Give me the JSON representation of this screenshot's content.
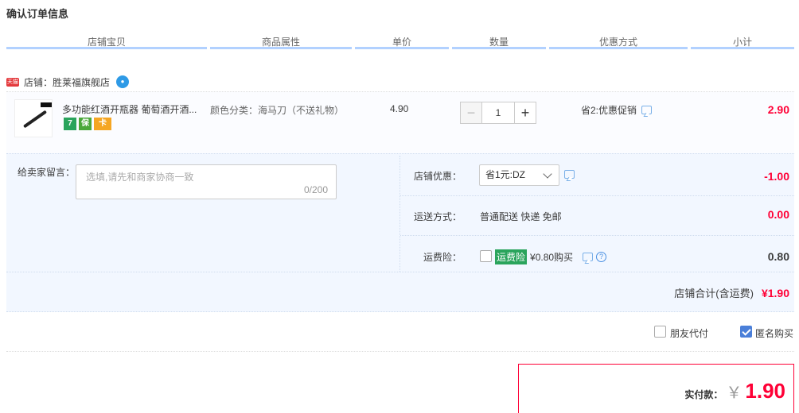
{
  "page": {
    "title": "确认订单信息"
  },
  "columns": [
    "店铺宝贝",
    "商品属性",
    "单价",
    "数量",
    "优惠方式",
    "小计"
  ],
  "shop": {
    "badge": "天猫",
    "label": "店铺：胜莱福旗舰店"
  },
  "item": {
    "title": "多功能红酒开瓶器 葡萄酒开酒...",
    "badges": [
      "7",
      "保",
      "卡"
    ],
    "attr": "颜色分类：海马刀（不送礼物）",
    "price": "4.90",
    "qty": "1",
    "minus": "−",
    "plus": "+",
    "promo": "省2:优惠促销",
    "subtotal": "2.90"
  },
  "message": {
    "label": "给卖家留言：",
    "placeholder": "选填,请先和商家协商一致",
    "counter": "0/200"
  },
  "store_discount": {
    "label": "店铺优惠：",
    "selected": "省1元:DZ",
    "amount": "-1.00"
  },
  "shipping": {
    "label": "运送方式：",
    "value": "普通配送 快递 免邮",
    "amount": "0.00"
  },
  "insurance": {
    "label": "运费险：",
    "tag": "运费险",
    "text": "¥0.80购买",
    "help": "?",
    "amount": "0.80"
  },
  "store_total": {
    "label": "店铺合计(含运费)",
    "value": "¥1.90"
  },
  "options": {
    "friend_pay": "朋友代付",
    "anonymous": "匿名购买"
  },
  "payment": {
    "label": "实付款：",
    "currency": "￥",
    "amount": "1.90"
  },
  "colors": {
    "accent_red": "#ff0036",
    "header_line": "#b2d1ff",
    "panel_bg": "#f2f7ff",
    "check_blue": "#4a7fd9"
  }
}
